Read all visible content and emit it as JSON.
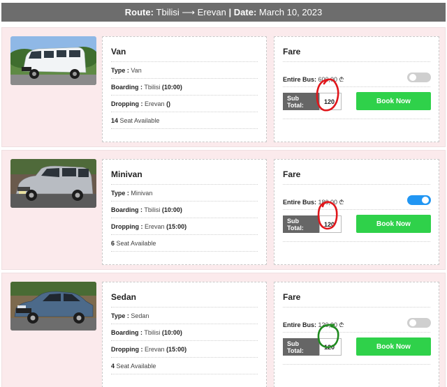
{
  "header": {
    "route_label": "Route:",
    "route_from": "Tbilisi",
    "arrow": "⟶",
    "route_to": "Erevan",
    "separator": "|",
    "date_label": "Date:",
    "date_value": "March 10, 2023"
  },
  "labels": {
    "type": "Type :",
    "boarding": "Boarding :",
    "dropping": "Dropping :",
    "seat_suffix": "Seat Available",
    "fare_title": "Fare",
    "entire_bus": "Entire Bus:",
    "sub_total": "Sub Total:",
    "book_now": "Book Now"
  },
  "vehicles": [
    {
      "name": "Van",
      "type": "Van",
      "boarding_city": "Tbilisi",
      "boarding_time": "(10:00)",
      "dropping_city": "Erevan",
      "dropping_time": "()",
      "seats": "14",
      "entire_bus_price": "600,00 ₾",
      "entire_bus_toggle": "off",
      "sub_total": "120",
      "annotation_color": "#e0161b"
    },
    {
      "name": "Minivan",
      "type": "Minivan",
      "boarding_city": "Tbilisi",
      "boarding_time": "(10:00)",
      "dropping_city": "Erevan",
      "dropping_time": "(15:00)",
      "seats": "6",
      "entire_bus_price": "180,00 ₾",
      "entire_bus_toggle": "on",
      "sub_total": "120",
      "annotation_color": "#e0161b"
    },
    {
      "name": "Sedan",
      "type": "Sedan",
      "boarding_city": "Tbilisi",
      "boarding_time": "(10:00)",
      "dropping_city": "Erevan",
      "dropping_time": "(15:00)",
      "seats": "4",
      "entire_bus_price": "120,00 ₾",
      "entire_bus_toggle": "off",
      "sub_total": "120",
      "annotation_color": "#1f8a1f"
    }
  ],
  "colors": {
    "header_bg": "#6d6d6d",
    "row_bg": "#fbeaec",
    "book_button": "#2fd14a",
    "toggle_on": "#2196f3",
    "toggle_off": "#cfcfcf",
    "subtotal_label_bg": "#666666"
  }
}
